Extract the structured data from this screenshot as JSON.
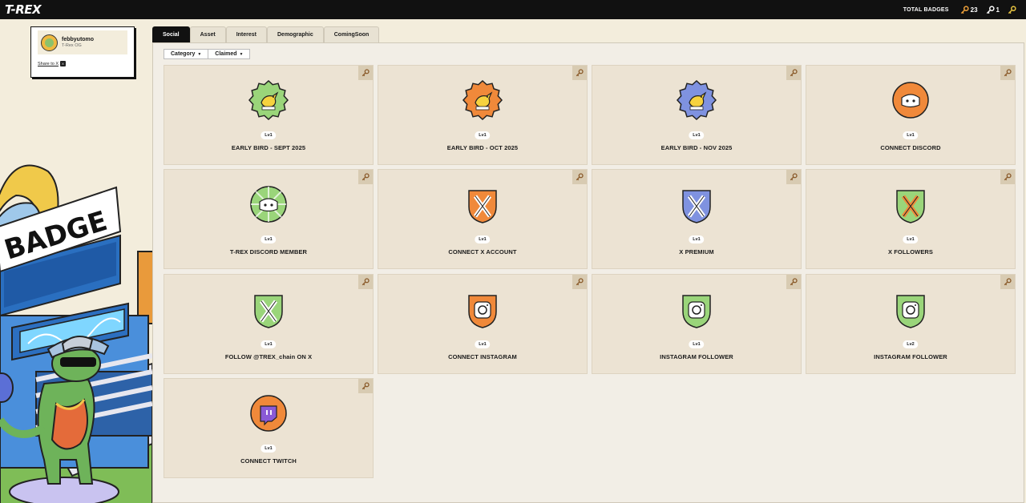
{
  "app": {
    "logo": "T-REX"
  },
  "header": {
    "total_badges_label": "TOTAL BADGES",
    "orange_keys": "23",
    "white_keys": "1"
  },
  "profile": {
    "username": "febbyutomo",
    "subtitle": "T-Rex OG",
    "share_label": "Share to X"
  },
  "illustration": {
    "sign_text": "BADGE"
  },
  "tabs": [
    {
      "label": "Social",
      "active": true
    },
    {
      "label": "Asset"
    },
    {
      "label": "Interest"
    },
    {
      "label": "Demographic"
    },
    {
      "label": "ComingSoon"
    }
  ],
  "filters": {
    "category": "Category",
    "claimed": "Claimed"
  },
  "badges": [
    {
      "name": "EARLY BIRD - SEPT 2025",
      "level": "Lv1",
      "icon": "early-bird-green"
    },
    {
      "name": "EARLY BIRD - OCT 2025",
      "level": "Lv1",
      "icon": "early-bird-orange"
    },
    {
      "name": "EARLY BIRD - NOV 2025",
      "level": "Lv1",
      "icon": "early-bird-blue"
    },
    {
      "name": "CONNECT DISCORD",
      "level": "Lv1",
      "icon": "discord-orange"
    },
    {
      "name": "T-REX DISCORD MEMBER",
      "level": "Lv1",
      "icon": "discord-green"
    },
    {
      "name": "CONNECT X ACCOUNT",
      "level": "Lv1",
      "icon": "x-orange"
    },
    {
      "name": "X PREMIUM",
      "level": "Lv1",
      "icon": "x-blue"
    },
    {
      "name": "X FOLLOWERS",
      "level": "Lv1",
      "icon": "x-green-orange"
    },
    {
      "name": "FOLLOW @TREX_chain ON X",
      "level": "Lv1",
      "icon": "x-green"
    },
    {
      "name": "CONNECT INSTAGRAM",
      "level": "Lv1",
      "icon": "instagram-orange"
    },
    {
      "name": "INSTAGRAM FOLLOWER",
      "level": "Lv1",
      "icon": "instagram-green"
    },
    {
      "name": "INSTAGRAM FOLLOWER",
      "level": "Lv2",
      "icon": "instagram-green"
    },
    {
      "name": "CONNECT TWITCH",
      "level": "Lv1",
      "icon": "twitch-orange"
    }
  ],
  "colors": {
    "orange": "#f0893a",
    "green": "#9ad57a",
    "blue": "#7f92e0",
    "cream": "#ece3d3"
  }
}
